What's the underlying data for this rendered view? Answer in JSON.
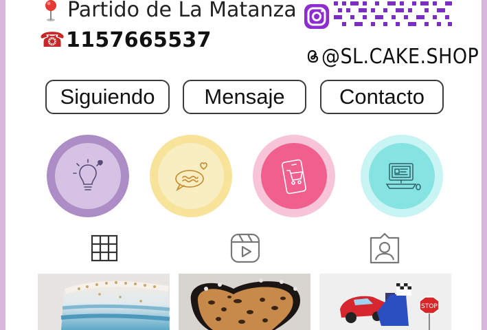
{
  "profile": {
    "location": "Partido de La Matanza",
    "phone": "1157665537",
    "handle": "@SL.CAKE.SHOP"
  },
  "icons": {
    "location": "map-pin-icon",
    "phone": "telephone-icon",
    "instagram": "instagram-icon",
    "threads": "threads-icon"
  },
  "actions": {
    "following": "Siguiendo",
    "message": "Mensaje",
    "contact": "Contacto"
  },
  "highlights": [
    {
      "icon": "lightbulb-icon",
      "color": "#ad8dc6"
    },
    {
      "icon": "speech-bubble-icon",
      "color": "#f7e39a"
    },
    {
      "icon": "shopping-cart-phone-icon",
      "color": "#f05f8e"
    },
    {
      "icon": "computer-icon",
      "color": "#85e3e1"
    }
  ],
  "tabs": [
    {
      "icon": "grid-icon",
      "active": true
    },
    {
      "icon": "reels-icon",
      "active": false
    },
    {
      "icon": "tagged-icon",
      "active": false
    }
  ],
  "posts": [
    {
      "subject": "blue-ombre-cake"
    },
    {
      "subject": "leopard-heart-cake"
    },
    {
      "subject": "cars-birthday-cake"
    }
  ],
  "colors": {
    "frame": "#d9b6dd",
    "instagram": "#8e2bd1",
    "qr": "#7a2fc0"
  }
}
